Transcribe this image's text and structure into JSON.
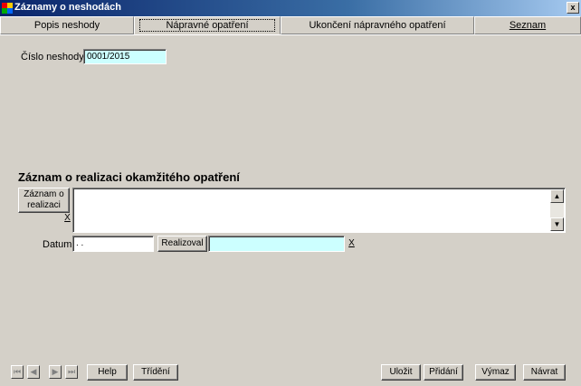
{
  "window": {
    "title": "Záznamy o neshodách"
  },
  "tabs": [
    {
      "label": "Popis neshody"
    },
    {
      "label": "Nápravné opatření"
    },
    {
      "label": "Ukončení nápravného opatření"
    },
    {
      "label": "Seznam"
    }
  ],
  "form": {
    "cislo_label": "Číslo neshody",
    "cislo_value": "0001/2015",
    "section_title": "Záznam o realizaci okamžitého opatření",
    "zaznam_button": "Záznam o realizaci",
    "clear_x": "X",
    "datum_label": "Datum",
    "datum_value": ". .",
    "realizoval_button": "Realizoval",
    "realizoval_value": ""
  },
  "footer": {
    "nav_first": "⏮",
    "nav_prev": "◀",
    "nav_next": "▶",
    "nav_last": "⏭",
    "help": "Help",
    "trideni": "Třídění",
    "ulozit": "Uložit",
    "pridani": "Přidání",
    "vymaz": "Výmaz",
    "navrat": "Návrat"
  },
  "colors": {
    "field_cyan": "#ccffff",
    "titlebar": "#0a246a"
  }
}
